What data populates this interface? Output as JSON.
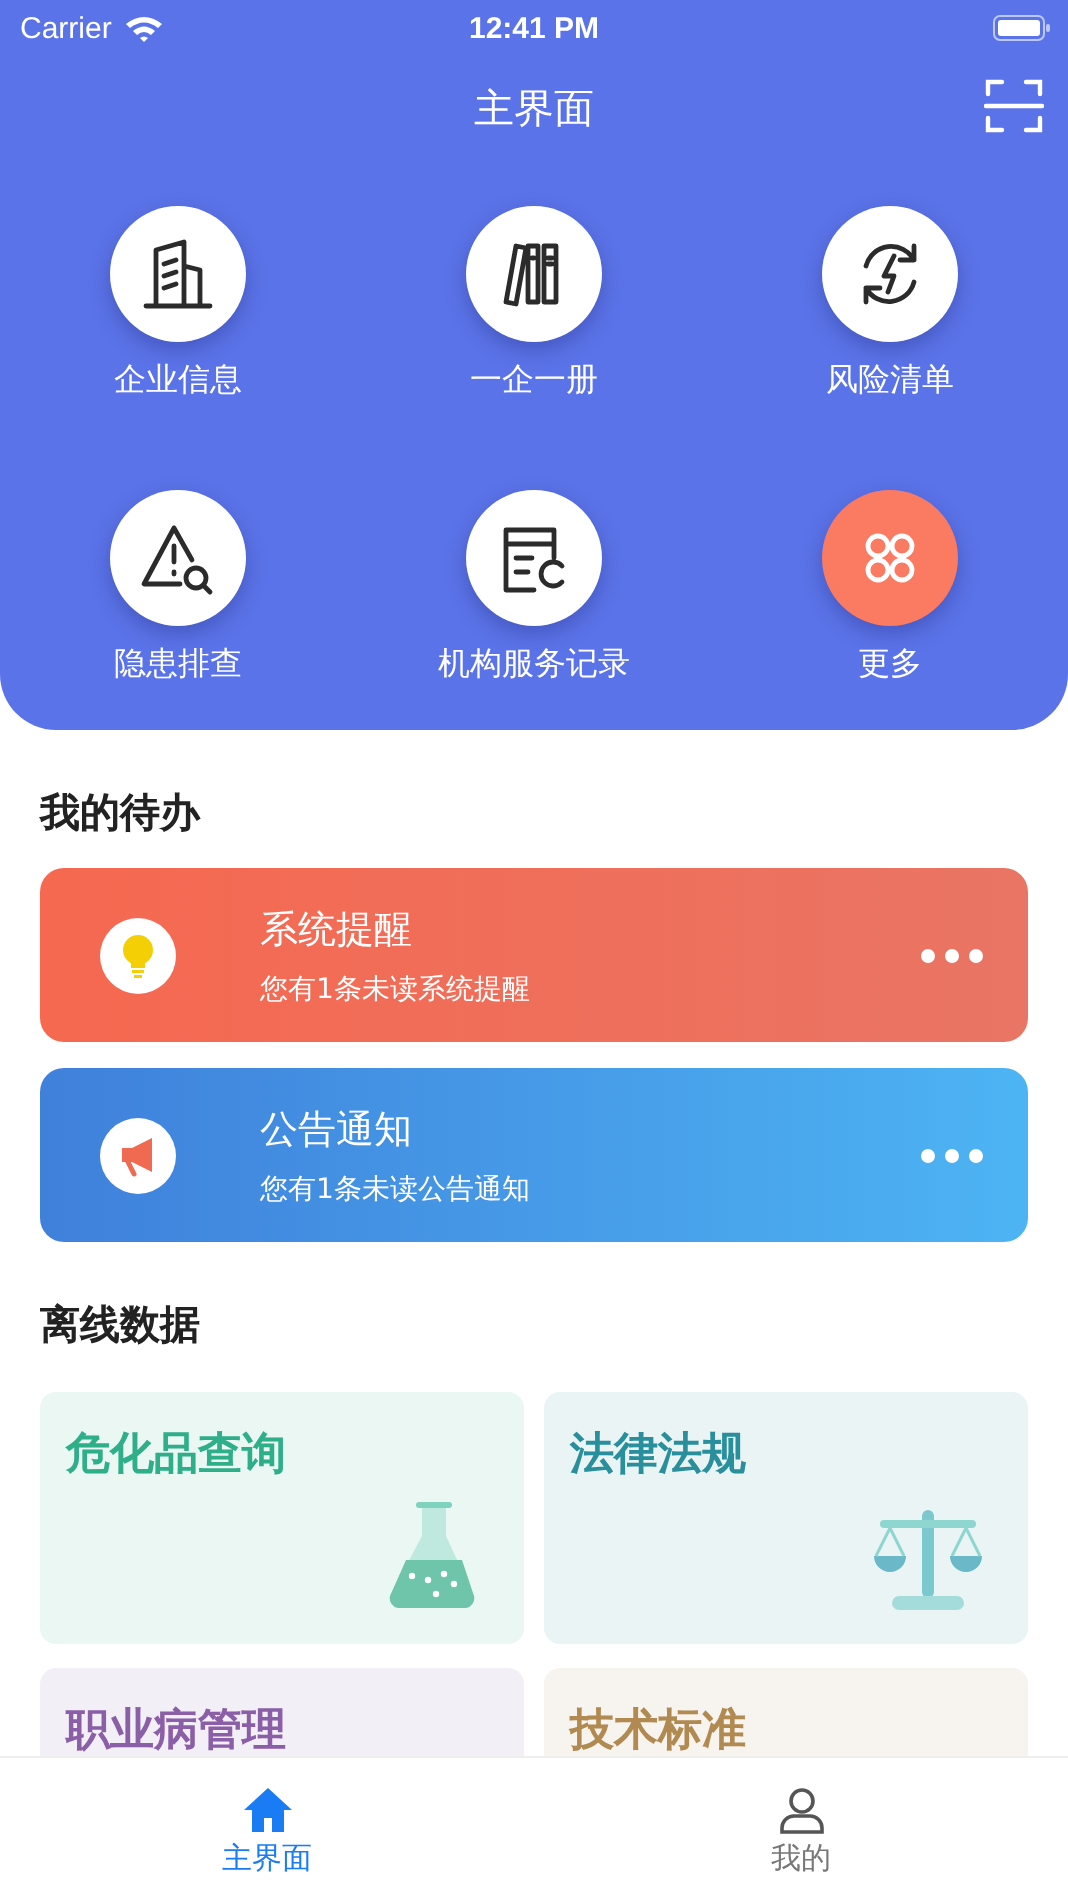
{
  "status_bar": {
    "carrier": "Carrier",
    "time": "12:41 PM"
  },
  "header": {
    "title": "主界面"
  },
  "menu": [
    {
      "label": "企业信息",
      "accent": false
    },
    {
      "label": "一企一册",
      "accent": false
    },
    {
      "label": "风险清单",
      "accent": false
    },
    {
      "label": "隐患排查",
      "accent": false
    },
    {
      "label": "机构服务记录",
      "accent": false
    },
    {
      "label": "更多",
      "accent": true
    }
  ],
  "todo": {
    "title": "我的待办",
    "items": [
      {
        "kind": "alert",
        "title": "系统提醒",
        "subtitle": "您有1条未读系统提醒"
      },
      {
        "kind": "notice",
        "title": "公告通知",
        "subtitle": "您有1条未读公告通知"
      }
    ]
  },
  "offline": {
    "title": "离线数据",
    "items": [
      {
        "label": "危化品查询",
        "color": "#2fae8a"
      },
      {
        "label": "法律法规",
        "color": "#2a8f9c"
      },
      {
        "label": "职业病管理",
        "color": "#8b5ea8"
      },
      {
        "label": "技术标准",
        "color": "#b08a50"
      }
    ]
  },
  "tabs": [
    {
      "label": "主界面",
      "selected": true
    },
    {
      "label": "我的",
      "selected": false
    }
  ]
}
